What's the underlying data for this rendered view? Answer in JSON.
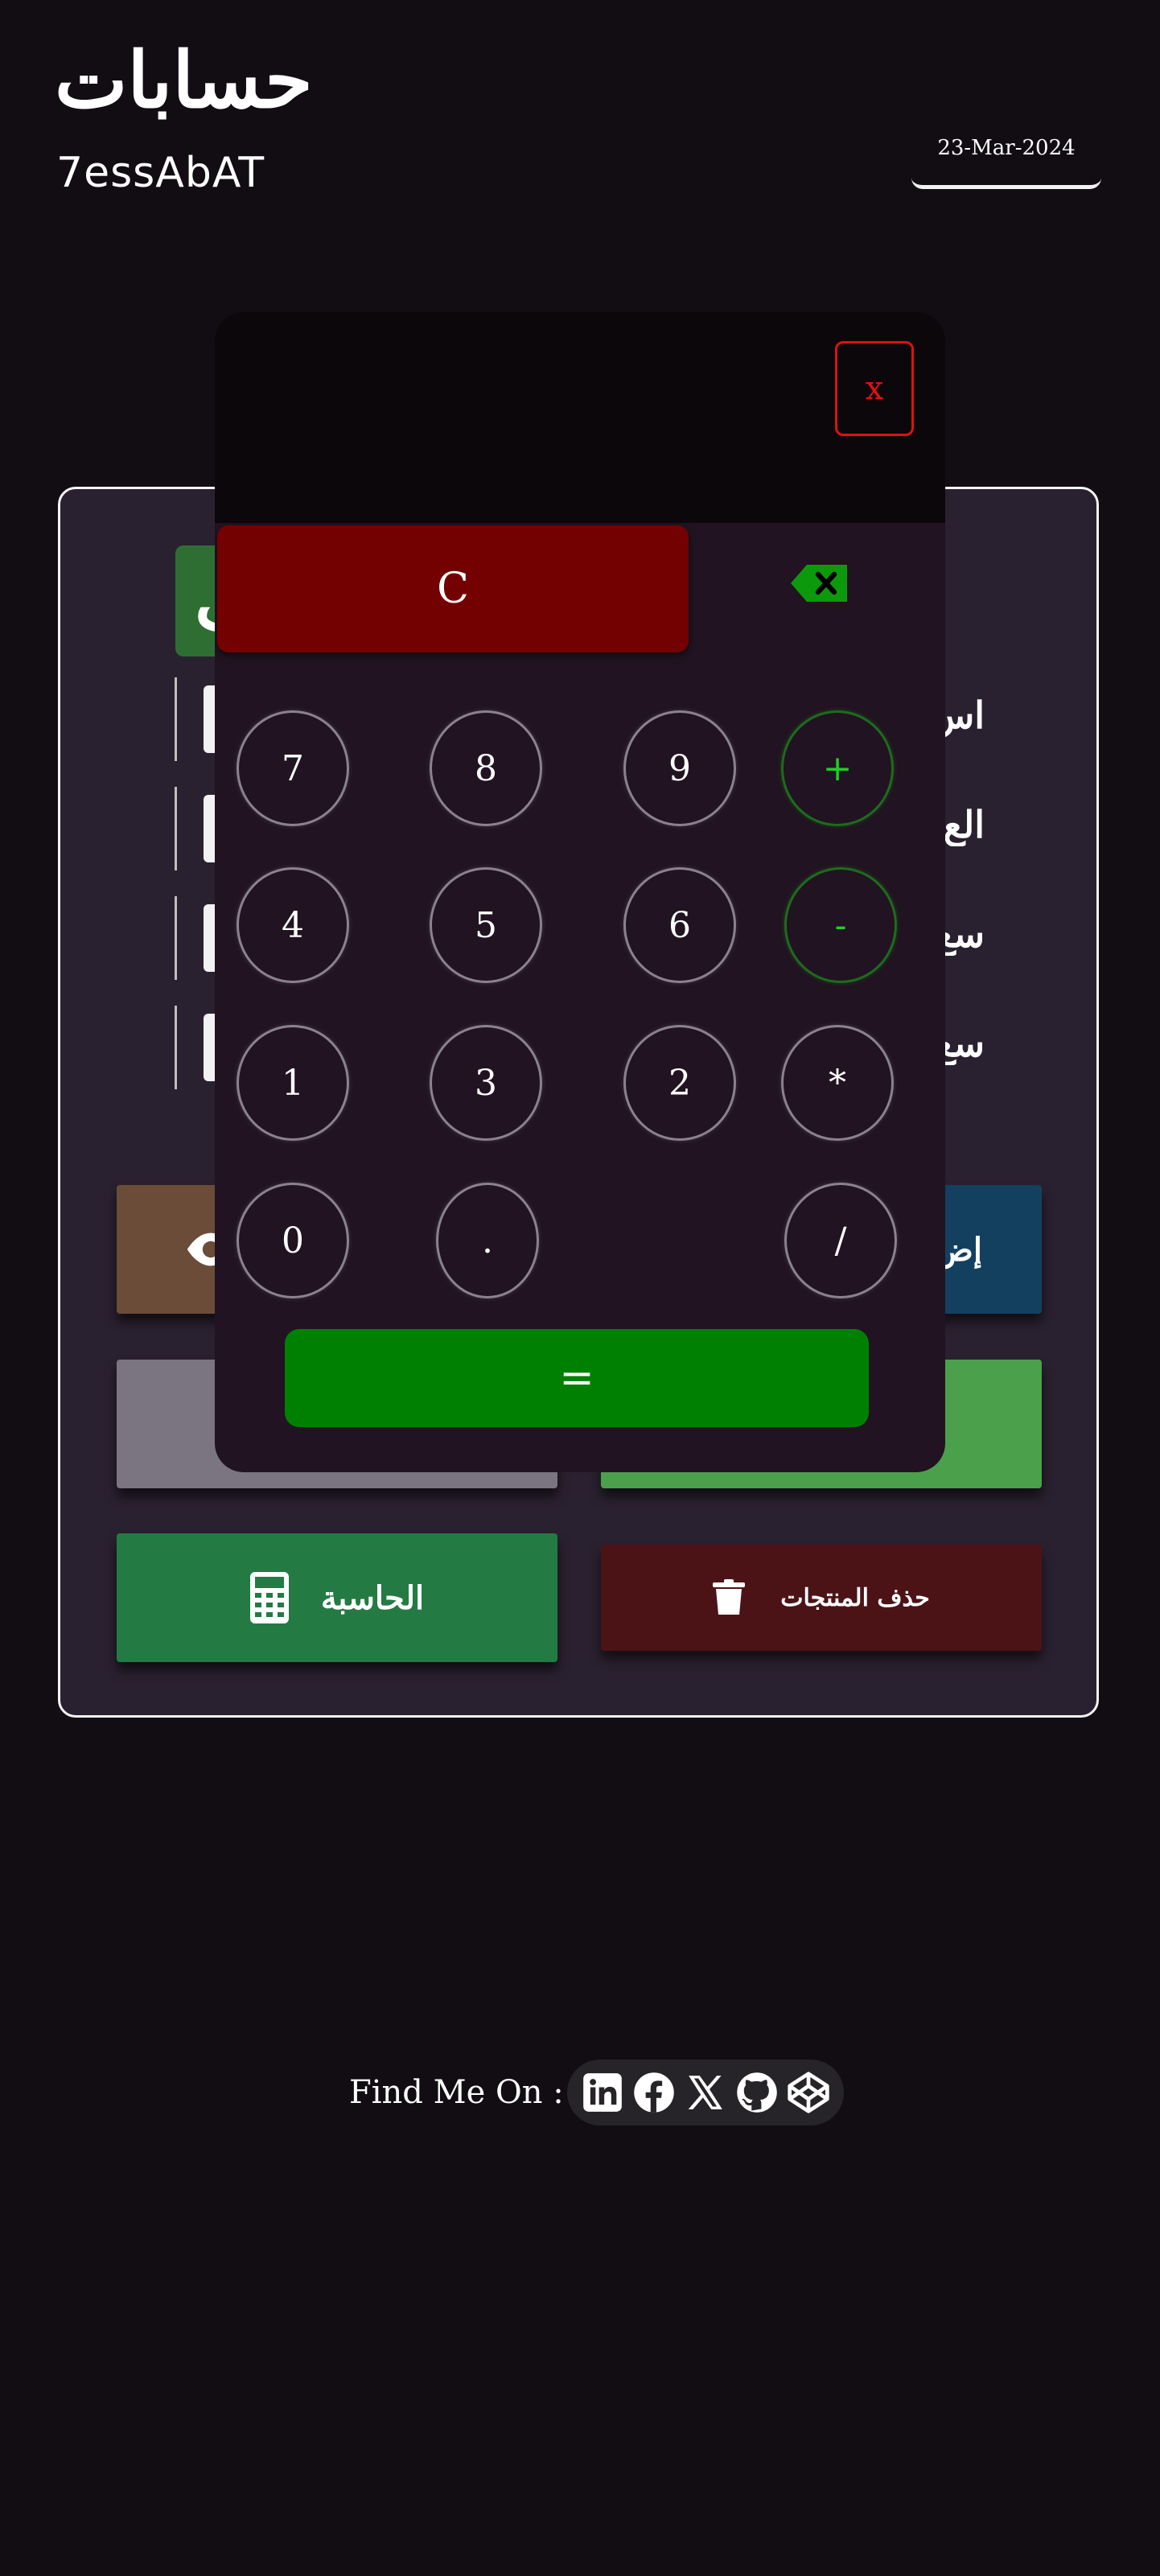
{
  "header": {
    "logo_arabic": "حسابات",
    "logo_latin": "7essAbAT",
    "date": "23-Mar-2024"
  },
  "form": {
    "labels": [
      "اس",
      "الع",
      "سع",
      "سع"
    ],
    "partial_button_glyph": "ف"
  },
  "buttons": {
    "add_partial": "إض",
    "calculator": "الحاسبة",
    "delete_products": "حذف المنتجات"
  },
  "calculator": {
    "close_label": "x",
    "clear_label": "C",
    "rows": [
      [
        "7",
        "8",
        "9",
        "+"
      ],
      [
        "4",
        "5",
        "6",
        "-"
      ],
      [
        "1",
        "3",
        "2",
        "*"
      ],
      [
        "0",
        ".",
        "/"
      ]
    ],
    "equals_label": "="
  },
  "footer": {
    "label": "Find Me On :",
    "social_icons": [
      "linkedin-icon",
      "facebook-icon",
      "x-twitter-icon",
      "github-icon",
      "codepen-icon"
    ]
  },
  "colors": {
    "background": "#110d12",
    "card": "#2a2130",
    "modal": "#211321",
    "clear": "#740101",
    "equals": "#008002",
    "operator_green": "#1fd01f",
    "close_red": "#e01010"
  }
}
